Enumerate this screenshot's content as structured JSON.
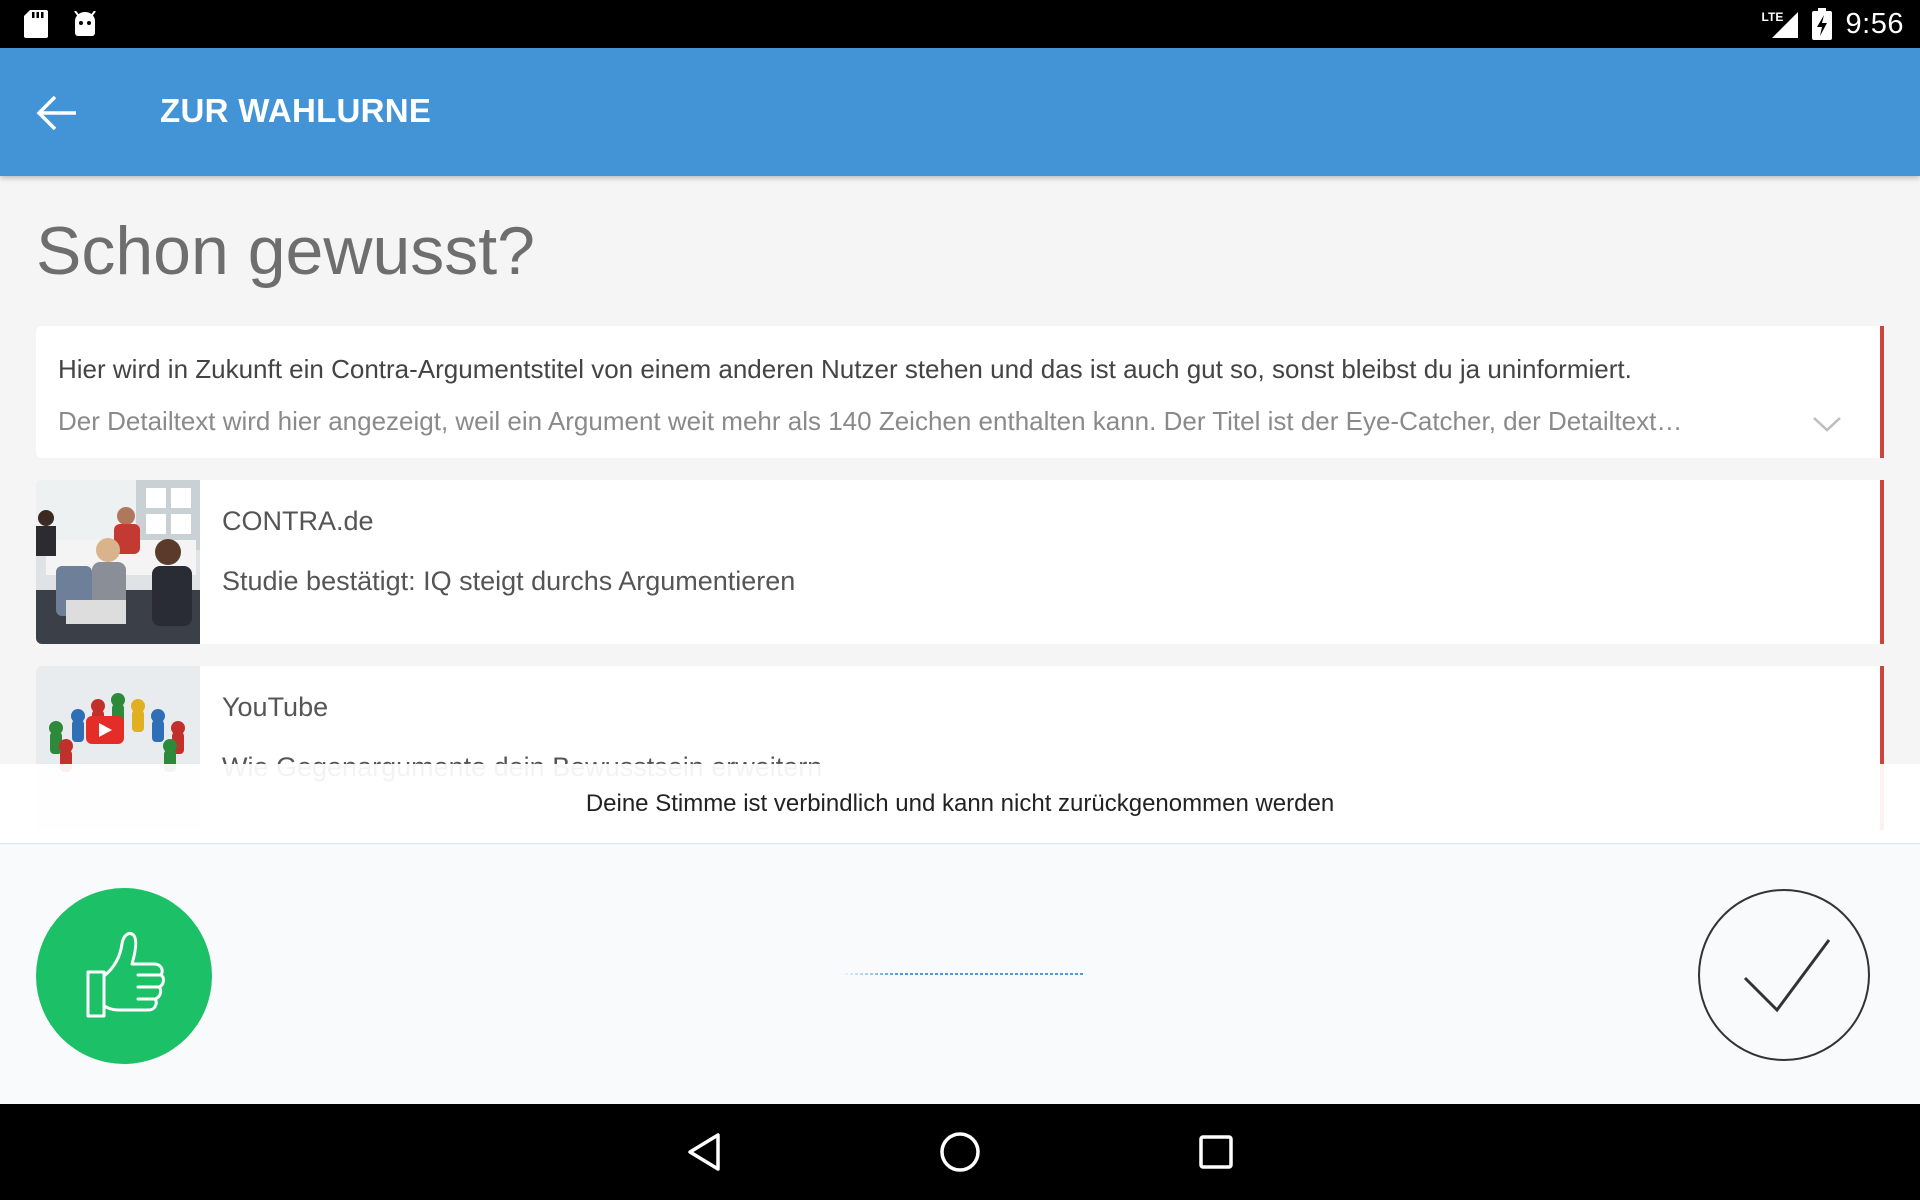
{
  "status_bar": {
    "time": "9:56",
    "network": "LTE",
    "left_icons": [
      "sd-card-icon",
      "android-icon"
    ],
    "right_icons": [
      "signal-icon",
      "battery-charging-icon"
    ]
  },
  "app_bar": {
    "title": "ZUR WAHLURNE",
    "back_icon": "arrow-left-icon",
    "color": "#4394d6"
  },
  "main": {
    "headline": "Schon gewusst?",
    "argument": {
      "title": "Hier wird in Zukunft ein Contra-Argumentstitel von einem anderen Nutzer stehen und das ist auch gut so, sonst bleibst du ja uninformiert.",
      "detail": "Der Detailtext wird hier angezeigt, weil ein Argument weit mehr als 140 Zeichen enthalten kann. Der Titel ist der Eye-Catcher, der Detailtext…",
      "expand_icon": "chevron-down-icon",
      "accent_color": "#c9463d"
    },
    "links": [
      {
        "source": "CONTRA.de",
        "title": "Studie bestätigt: IQ steigt durchs Argumentieren",
        "thumbnail": "meeting-photo"
      },
      {
        "source": "YouTube",
        "title": "Wie Gegenargumente dein Bewusstsein erweitern",
        "thumbnail": "game-pieces-video-thumbnail",
        "overlay_icon": "youtube-play-icon"
      }
    ]
  },
  "notice": {
    "text": "Deine Stimme ist verbindlich und kann nicht zurückgenommen werden"
  },
  "vote": {
    "choice_icon": "thumbs-up-icon",
    "choice_color": "#1cc167",
    "confirm_icon": "checkmark-icon"
  },
  "nav_bar": {
    "buttons": [
      "back-triangle-icon",
      "home-circle-icon",
      "recents-square-icon"
    ]
  }
}
